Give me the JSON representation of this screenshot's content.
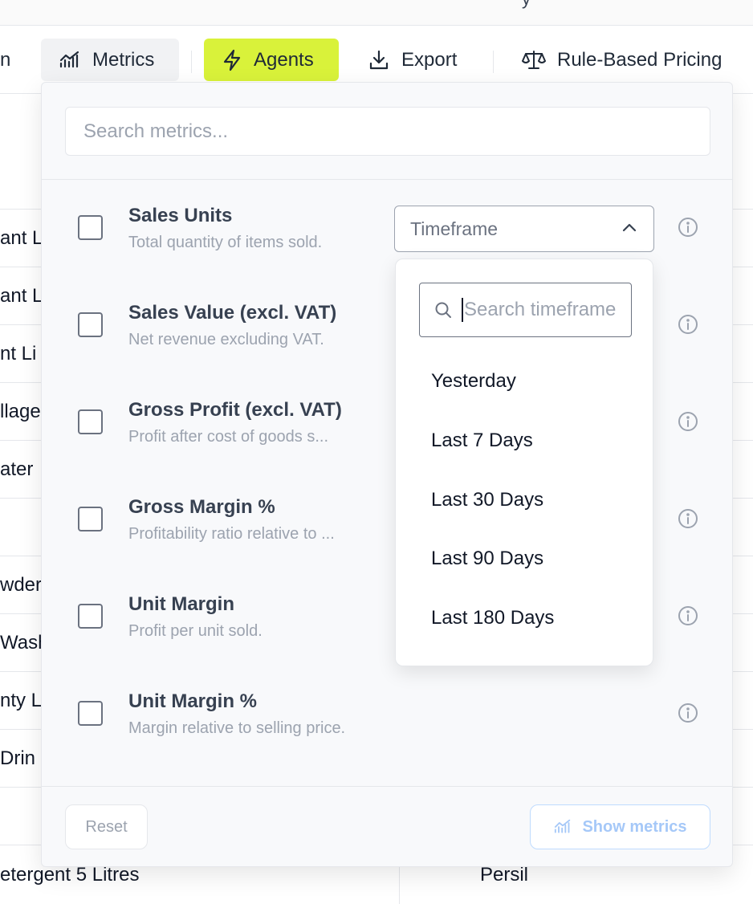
{
  "header_fragment": "y",
  "toolbar": {
    "left_fragment": "n",
    "metrics_label": "Metrics",
    "agents_label": "Agents",
    "export_label": "Export",
    "rule_pricing_label": "Rule-Based Pricing",
    "agents_color": "#d9f23a"
  },
  "background_rows": [
    "ant L",
    "ant L",
    "nt Li",
    "llage",
    "ater",
    "",
    "wder",
    "Wash",
    "nty L",
    " Drin",
    ""
  ],
  "bottom_row": {
    "name": "etergent 5 Litres",
    "brand": "Persil"
  },
  "metrics_panel": {
    "search_placeholder": "Search metrics...",
    "metrics": [
      {
        "title": "Sales Units",
        "description": "Total quantity of items sold."
      },
      {
        "title": "Sales Value (excl. VAT)",
        "description": "Net revenue excluding VAT."
      },
      {
        "title": "Gross Profit (excl. VAT)",
        "description": "Profit after cost of goods s..."
      },
      {
        "title": "Gross Margin %",
        "description": "Profitability ratio relative to ..."
      },
      {
        "title": "Unit Margin",
        "description": "Profit per unit sold."
      },
      {
        "title": "Unit Margin %",
        "description": "Margin relative to selling price."
      }
    ],
    "timeframe": {
      "placeholder": "Timeframe",
      "search_placeholder": "Search timeframe",
      "options": [
        "Yesterday",
        "Last 7 Days",
        "Last 30 Days",
        "Last 90 Days",
        "Last 180 Days"
      ]
    },
    "reset_label": "Reset",
    "show_label": "Show metrics"
  }
}
